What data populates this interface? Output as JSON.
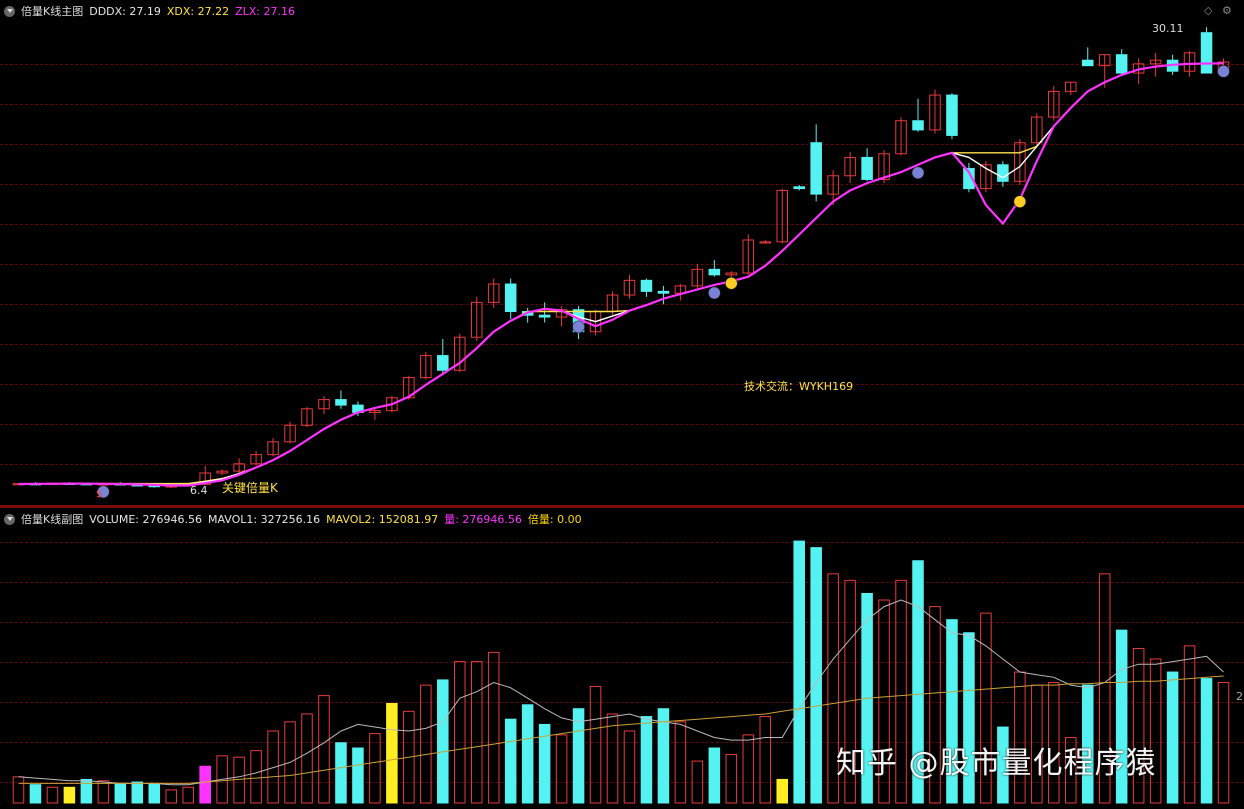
{
  "main": {
    "title": "倍量K线主图",
    "indicators": [
      {
        "label": "DDDX: 27.19",
        "color": "#e6e6e6"
      },
      {
        "label": "XDX: 27.22",
        "color": "#ffe24a"
      },
      {
        "label": "ZLX: 27.16",
        "color": "#ff33ff"
      }
    ],
    "high_label": "30.11",
    "low_label": "6.4",
    "annotation_text": "技术交流：WYKH169",
    "signal_text": "关键倍量K",
    "marker_text": "$"
  },
  "sub": {
    "title": "倍量K线副图",
    "indicators": [
      {
        "label": "VOLUME: 276946.56",
        "color": "#e6e6e6"
      },
      {
        "label": "MAVOL1: 327256.16",
        "color": "#e6e6e6"
      },
      {
        "label": "MAVOL2: 152081.97",
        "color": "#ffe24a"
      },
      {
        "label": "量: 276946.56",
        "color": "#ff33ff"
      },
      {
        "label": "倍量: 0.00",
        "color": "#ffd800"
      }
    ],
    "right_label": "2",
    "watermark": "知乎 @股市量化程序猿"
  },
  "colors": {
    "up": "#e83a3a",
    "down": "#55f2f2",
    "ma_fast": "#ffffff",
    "ma_mid": "#ffe24a",
    "ma_slow": "#ff33ff",
    "double_volume": "#ffee22",
    "vol_ma1": "#bbbbbb",
    "vol_ma2": "#c9a23a"
  },
  "candles": [
    [
      6.4,
      6.45,
      6.35,
      6.42
    ],
    [
      6.42,
      6.5,
      6.38,
      6.4
    ],
    [
      6.4,
      6.46,
      6.36,
      6.44
    ],
    [
      6.44,
      6.5,
      6.4,
      6.42
    ],
    [
      6.42,
      6.48,
      6.36,
      6.39
    ],
    [
      6.39,
      6.45,
      6.33,
      6.41
    ],
    [
      6.41,
      6.5,
      6.38,
      6.36
    ],
    [
      6.36,
      6.42,
      6.3,
      6.34
    ],
    [
      6.34,
      6.4,
      6.2,
      6.25
    ],
    [
      6.25,
      6.32,
      6.18,
      6.3
    ],
    [
      6.3,
      6.4,
      6.26,
      6.38
    ],
    [
      6.38,
      7.4,
      6.36,
      7.0
    ],
    [
      7.0,
      7.2,
      6.9,
      7.1
    ],
    [
      7.1,
      7.8,
      7.0,
      7.5
    ],
    [
      7.5,
      8.2,
      7.4,
      8.0
    ],
    [
      8.0,
      8.9,
      7.9,
      8.7
    ],
    [
      8.7,
      9.8,
      8.6,
      9.6
    ],
    [
      9.6,
      10.6,
      9.5,
      10.5
    ],
    [
      10.5,
      11.2,
      10.2,
      11.0
    ],
    [
      11.0,
      11.5,
      10.5,
      10.7
    ],
    [
      10.7,
      10.9,
      10.1,
      10.3
    ],
    [
      10.3,
      10.5,
      9.9,
      10.4
    ],
    [
      10.4,
      11.2,
      10.3,
      11.1
    ],
    [
      11.1,
      12.3,
      11.0,
      12.2
    ],
    [
      12.2,
      13.6,
      12.1,
      13.4
    ],
    [
      13.4,
      14.3,
      12.4,
      12.6
    ],
    [
      12.6,
      14.6,
      12.5,
      14.4
    ],
    [
      14.4,
      16.6,
      14.2,
      16.3
    ],
    [
      16.3,
      17.6,
      16.0,
      17.3
    ],
    [
      17.3,
      17.6,
      15.4,
      15.8
    ],
    [
      15.8,
      16.0,
      15.2,
      15.6
    ],
    [
      15.6,
      16.3,
      15.2,
      15.5
    ],
    [
      15.5,
      16.1,
      15.0,
      15.9
    ],
    [
      15.9,
      16.1,
      14.3,
      14.7
    ],
    [
      14.7,
      15.9,
      14.5,
      15.8
    ],
    [
      15.8,
      16.9,
      15.6,
      16.7
    ],
    [
      16.7,
      17.8,
      16.5,
      17.5
    ],
    [
      17.5,
      17.6,
      16.6,
      16.9
    ],
    [
      16.9,
      17.2,
      16.2,
      16.8
    ],
    [
      16.8,
      17.3,
      16.4,
      17.2
    ],
    [
      17.2,
      18.4,
      17.0,
      18.1
    ],
    [
      18.1,
      18.6,
      17.7,
      17.8
    ],
    [
      17.8,
      18.0,
      17.3,
      17.9
    ],
    [
      17.9,
      20.0,
      17.8,
      19.7
    ],
    [
      19.6,
      19.7,
      19.5,
      19.6
    ],
    [
      19.6,
      22.5,
      19.5,
      22.4
    ],
    [
      22.6,
      22.7,
      22.4,
      22.5
    ],
    [
      25.0,
      26.0,
      21.8,
      22.2
    ],
    [
      22.2,
      23.5,
      21.6,
      23.2
    ],
    [
      23.2,
      24.5,
      22.8,
      24.2
    ],
    [
      24.2,
      24.7,
      22.9,
      23.0
    ],
    [
      23.0,
      24.6,
      22.8,
      24.4
    ],
    [
      24.4,
      26.4,
      24.3,
      26.2
    ],
    [
      26.2,
      27.4,
      25.6,
      25.7
    ],
    [
      25.7,
      27.9,
      25.5,
      27.6
    ],
    [
      27.6,
      27.7,
      25.2,
      25.4
    ],
    [
      23.6,
      23.9,
      22.3,
      22.5
    ],
    [
      22.5,
      24.0,
      22.3,
      23.8
    ],
    [
      23.8,
      24.0,
      22.6,
      22.9
    ],
    [
      22.9,
      25.2,
      22.7,
      25.0
    ],
    [
      25.0,
      26.6,
      24.8,
      26.4
    ],
    [
      26.4,
      28.1,
      26.2,
      27.8
    ],
    [
      27.8,
      28.3,
      27.6,
      28.3
    ],
    [
      29.5,
      30.2,
      29.3,
      29.2
    ],
    [
      29.2,
      29.8,
      28.0,
      29.8
    ],
    [
      29.8,
      30.1,
      28.7,
      28.8
    ],
    [
      28.8,
      29.6,
      28.2,
      29.3
    ],
    [
      29.3,
      29.9,
      28.6,
      29.5
    ],
    [
      29.5,
      29.8,
      28.7,
      28.9
    ],
    [
      28.9,
      30.0,
      28.6,
      29.9
    ],
    [
      31.0,
      31.3,
      29.0,
      28.8
    ],
    [
      28.8,
      29.6,
      28.6,
      29.4
    ]
  ],
  "volumes": [
    20,
    14,
    12,
    12,
    18,
    17,
    15,
    16,
    15,
    10,
    12,
    28,
    36,
    35,
    40,
    55,
    62,
    68,
    82,
    46,
    42,
    53,
    76,
    70,
    90,
    94,
    108,
    108,
    115,
    64,
    75,
    60,
    52,
    72,
    89,
    68,
    55,
    66,
    72,
    62,
    32,
    42,
    37,
    52,
    66,
    18,
    200,
    195,
    175,
    170,
    160,
    155,
    170,
    185,
    150,
    140,
    130,
    145,
    58,
    100,
    90,
    92,
    50,
    90,
    175,
    132,
    118,
    110,
    100,
    120,
    95,
    92
  ],
  "double_volume_flags": [
    3,
    22,
    45
  ],
  "ma_fast": [
    6.4,
    6.41,
    6.41,
    6.42,
    6.42,
    6.41,
    6.4,
    6.39,
    6.37,
    6.35,
    6.35,
    6.52,
    6.68,
    6.96,
    7.3,
    7.7,
    8.2,
    8.8,
    9.4,
    9.9,
    10.3,
    10.55,
    10.75,
    11.15,
    11.8,
    12.4,
    13.0,
    13.8,
    14.7,
    15.3,
    15.75,
    15.95,
    15.85,
    15.5,
    15.25,
    15.55,
    15.85,
    16.15,
    16.5,
    16.75,
    17.0,
    17.25,
    17.45,
    17.7,
    18.3,
    19.1,
    20.0,
    20.9,
    21.8,
    22.4,
    22.8,
    23.1,
    23.4,
    23.8,
    24.2,
    24.45,
    24.2,
    23.6,
    23.1,
    23.7,
    24.8,
    25.9,
    26.9,
    27.8,
    28.3,
    28.7,
    29.0,
    29.15,
    29.25,
    29.3,
    29.32,
    29.33
  ],
  "ma_mid": [
    6.4,
    6.41,
    6.41,
    6.42,
    6.42,
    6.42,
    6.42,
    6.42,
    6.42,
    6.42,
    6.42,
    6.55,
    6.7,
    6.96,
    7.3,
    7.7,
    8.2,
    8.8,
    9.4,
    9.9,
    10.3,
    10.55,
    10.75,
    11.15,
    11.8,
    12.4,
    13.0,
    13.8,
    14.7,
    15.3,
    15.8,
    15.8,
    15.8,
    15.8,
    15.8,
    15.8,
    15.85,
    16.15,
    16.5,
    16.75,
    17.0,
    17.25,
    17.45,
    17.7,
    18.3,
    19.1,
    20.0,
    20.9,
    21.8,
    22.4,
    22.8,
    23.1,
    23.4,
    23.8,
    24.2,
    24.45,
    24.45,
    24.45,
    24.45,
    24.45,
    24.8,
    25.9,
    26.9,
    27.8,
    28.3,
    28.7,
    29.0,
    29.15,
    29.25,
    29.3,
    29.32,
    29.33
  ],
  "ma_slow": [
    6.4,
    6.41,
    6.41,
    6.42,
    6.42,
    6.41,
    6.4,
    6.38,
    6.35,
    6.32,
    6.32,
    6.45,
    6.6,
    6.9,
    7.3,
    7.7,
    8.2,
    8.8,
    9.4,
    9.9,
    10.3,
    10.55,
    10.75,
    11.15,
    11.8,
    12.4,
    13.0,
    13.8,
    14.7,
    15.3,
    15.75,
    15.95,
    15.85,
    15.4,
    15.0,
    15.35,
    15.85,
    16.15,
    16.5,
    16.75,
    17.0,
    17.25,
    17.45,
    17.7,
    18.3,
    19.1,
    20.0,
    20.9,
    21.8,
    22.4,
    22.8,
    23.1,
    23.4,
    23.8,
    24.2,
    24.45,
    23.4,
    21.6,
    20.6,
    21.9,
    24.0,
    25.9,
    26.9,
    27.8,
    28.3,
    28.7,
    29.0,
    29.15,
    29.25,
    29.3,
    29.32,
    29.33
  ],
  "vol_ma1": [
    20,
    19,
    18,
    17,
    17,
    16,
    15,
    15,
    15,
    14,
    14,
    16,
    18,
    20,
    23,
    27,
    31,
    38,
    46,
    55,
    60,
    58,
    56,
    55,
    57,
    62,
    80,
    85,
    92,
    88,
    80,
    72,
    65,
    62,
    64,
    66,
    68,
    64,
    62,
    60,
    55,
    50,
    48,
    48,
    50,
    50,
    72,
    92,
    110,
    125,
    140,
    150,
    155,
    150,
    140,
    130,
    128,
    120,
    110,
    100,
    98,
    96,
    90,
    88,
    92,
    102,
    106,
    106,
    108,
    110,
    112,
    100
  ],
  "vol_ma2": [
    15,
    15,
    15,
    15,
    15,
    15,
    15,
    15,
    15,
    15,
    15,
    16,
    17,
    18,
    19,
    20,
    21,
    23,
    25,
    27,
    29,
    31,
    33,
    35,
    37,
    39,
    41,
    43,
    45,
    47,
    49,
    51,
    53,
    55,
    57,
    59,
    60,
    61,
    62,
    63,
    64,
    65,
    66,
    67,
    68,
    70,
    72,
    74,
    76,
    78,
    80,
    81,
    82,
    83,
    84,
    85,
    86,
    87,
    88,
    89,
    90,
    90,
    91,
    91,
    92,
    92,
    93,
    93,
    94,
    95,
    96,
    97
  ]
}
